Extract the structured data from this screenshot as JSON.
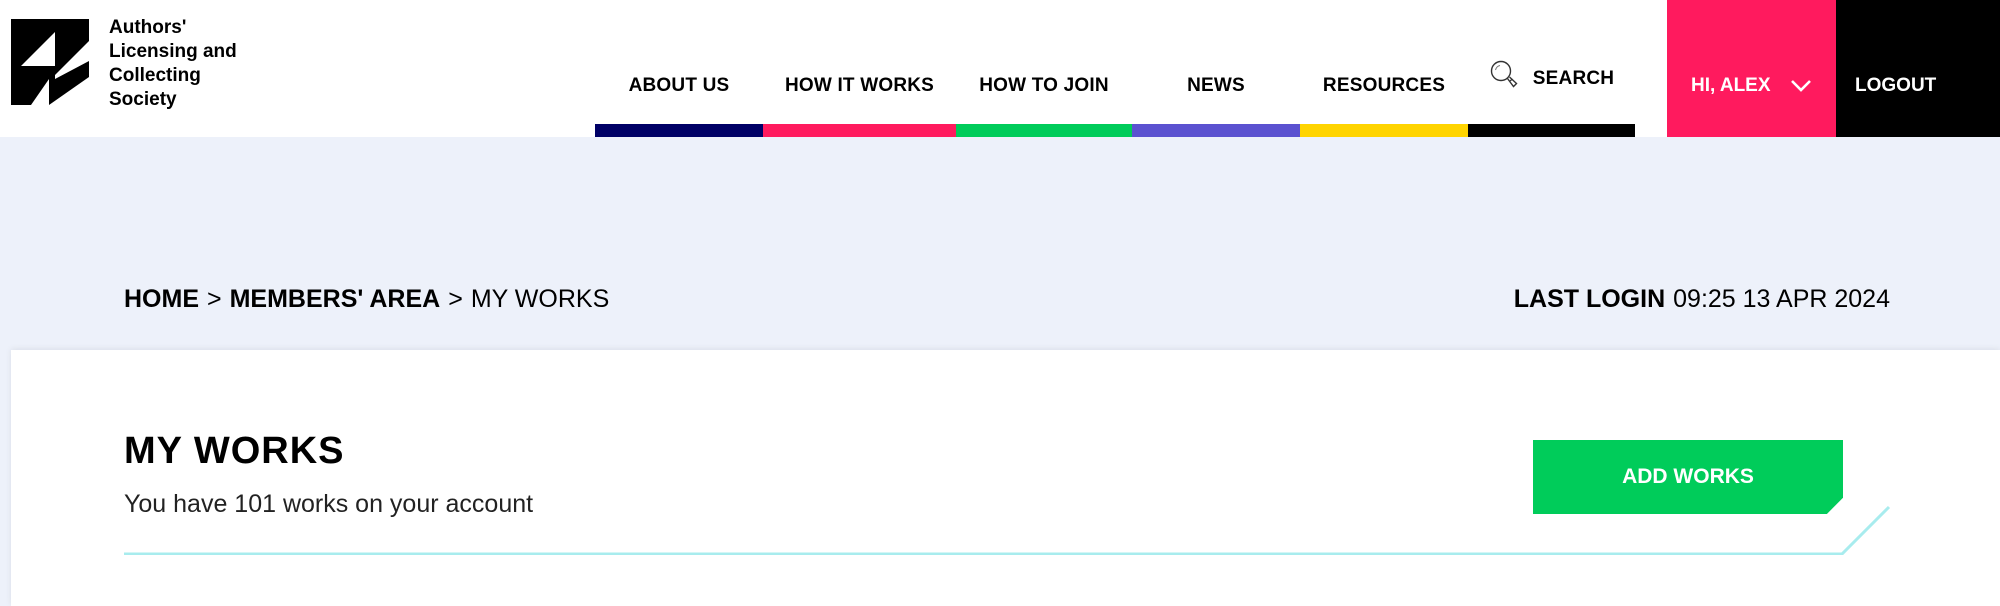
{
  "brand": {
    "logo_lines": [
      "Authors'",
      "Licensing and",
      "Collecting",
      "Society"
    ],
    "logo_icon": "alcs-logo-icon"
  },
  "nav": {
    "items": [
      {
        "label": "ABOUT US",
        "bar_color": "#000066"
      },
      {
        "label": "HOW IT WORKS",
        "bar_color": "#ff1a5e"
      },
      {
        "label": "HOW TO JOIN",
        "bar_color": "#00cc5a"
      },
      {
        "label": "NEWS",
        "bar_color": "#5b52d0"
      },
      {
        "label": "RESOURCES",
        "bar_color": "#ffd400"
      },
      {
        "label": "SEARCH",
        "bar_color": "#000000",
        "icon": "search-icon"
      }
    ],
    "user_greeting": "HI, ALEX",
    "user_menu_color": "#ff1a5e",
    "logout_label": "LOGOUT"
  },
  "breadcrumb": {
    "items": [
      "HOME",
      "MEMBERS' AREA",
      "MY WORKS"
    ],
    "separator": ">"
  },
  "last_login": {
    "label": "LAST LOGIN",
    "value": "09:25 13 APR 2024"
  },
  "main": {
    "title": "MY WORKS",
    "subtitle": "You have 101 works on your account",
    "add_button_label": "ADD WORKS",
    "accent_color": "#00cc5a",
    "divider_color": "#a8ecee"
  }
}
